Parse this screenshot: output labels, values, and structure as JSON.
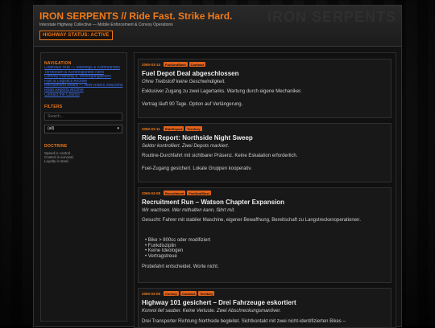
{
  "header": {
    "title": "IRON SERPENTS // Ride Fast. Strike Hard.",
    "watermark": "IRON SERPENTS",
    "subtitle": "Interstate Highway Collective — Mobile Enforcement & Convoy Operations",
    "status": "HIGHWAY STATUS: ACTIVE"
  },
  "sidebar": {
    "nav_heading": "NAVIGATION",
    "nav_links": [
      "Clubhaus Hub — Meetings & Kommandos",
      "Territorium & Kontrollpunkte Nord",
      "Convoy-Planung & Versorgungslinien",
      "Fuel & Logistics Archive",
      "Recruitment Board — New Riders Welcome",
      "Road Reports Archive",
      "Contact the Council"
    ],
    "filters_heading": "FILTERS",
    "search_placeholder": "Search...",
    "select_value": "(all)",
    "doctrine_heading": "DOCTRINE",
    "doctrine_lines": [
      "Speed is control.",
      "Control is survival.",
      "Loyalty is steel."
    ]
  },
  "posts": [
    {
      "date": "2060-03-14",
      "tags": [
        "FuelAndSteel",
        "Contract"
      ],
      "title": "Fuel Depot Deal abgeschlossen",
      "subtitle": "Ohne Treibstoff keine Geschwindigkeit.",
      "paragraphs": [
        "Exklusiver Zugang zu zwei Lagertanks. Wartung durch eigene Mechaniker.",
        "Vertrag läuft 90 Tage. Option auf Verlängerung."
      ]
    },
    {
      "date": "2060-03-11",
      "tags": [
        "RideReport",
        "Territory"
      ],
      "title": "Ride Report: Northside Night Sweep",
      "subtitle": "Sektor kontrolliert. Zwei Depots markiert.",
      "paragraphs": [
        "Routine-Durchfahrt mit sichtbarer Präsenz. Keine Eskalation erforderlich.",
        "Fuel-Zugang gesichert. Lokale Gruppen kooperativ."
      ]
    },
    {
      "date": "2060-03-08",
      "tags": [
        "Recruitment",
        "FuelAndSteel"
      ],
      "title": "Recruitment Run – Watson Chapter Expansion",
      "subtitle": "Wir wachsen. Wer mithalten kann, fährt mit.",
      "paragraphs": [
        "Gesucht: Fahrer mit stabiler Maschine, eigener Bewaffnung, Bereitschaft zu Langstreckenoperationen.",
        "Probefahrt entscheidet. Worte nicht."
      ],
      "bullets": [
        "Bike > 800cc oder modifiziert",
        "Funkdisziplin",
        "Keine Ideologen",
        "Vertragstreue"
      ]
    },
    {
      "date": "2060-03-05",
      "tags": [
        "Convoy",
        "Contract",
        "Territory"
      ],
      "title": "Highway 101 gesichert – Drei Fahrzeuge eskortiert",
      "subtitle": "Konvoi lief sauber. Keine Verluste. Zwei Abschreckungsmanöver.",
      "paragraphs": [
        "Drei Transporter Richtung Northside begleitet. Sichtkontakt mit zwei nicht-identifizierten Bikes –"
      ]
    }
  ],
  "colors": {
    "accent": "#f07a1a",
    "link": "#3c6ee7",
    "tag_bg": "#e0621c"
  }
}
